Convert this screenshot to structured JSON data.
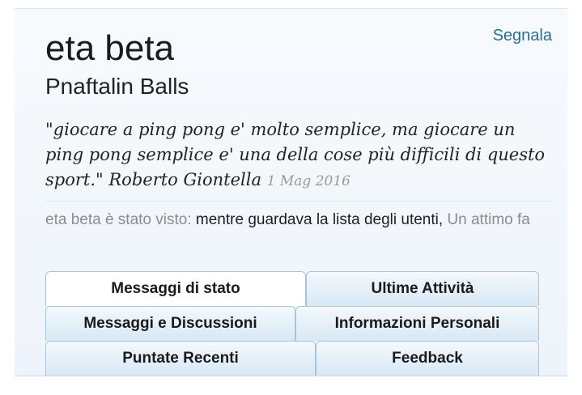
{
  "profile": {
    "username": "eta beta",
    "title": "Pnaftalin Balls",
    "report_label": "Segnala"
  },
  "quote": {
    "text": "\"giocare a ping pong e' molto semplice, ma giocare un ping pong semplice e' una della cose più difficili di questo sport.\"",
    "author": "Roberto Giontella",
    "date": "1 Mag 2016"
  },
  "last_seen": {
    "prefix": "eta beta è stato visto:",
    "activity": "mentre guardava la lista degli utenti,",
    "time": "Un attimo fa"
  },
  "tabs": [
    {
      "label": "Messaggi di stato",
      "active": true
    },
    {
      "label": "Ultime Attività",
      "active": false
    },
    {
      "label": "Messaggi e Discussioni",
      "active": false
    },
    {
      "label": "Informazioni Personali",
      "active": false
    },
    {
      "label": "Puntate Recenti",
      "active": false
    },
    {
      "label": "Feedback",
      "active": false
    }
  ]
}
